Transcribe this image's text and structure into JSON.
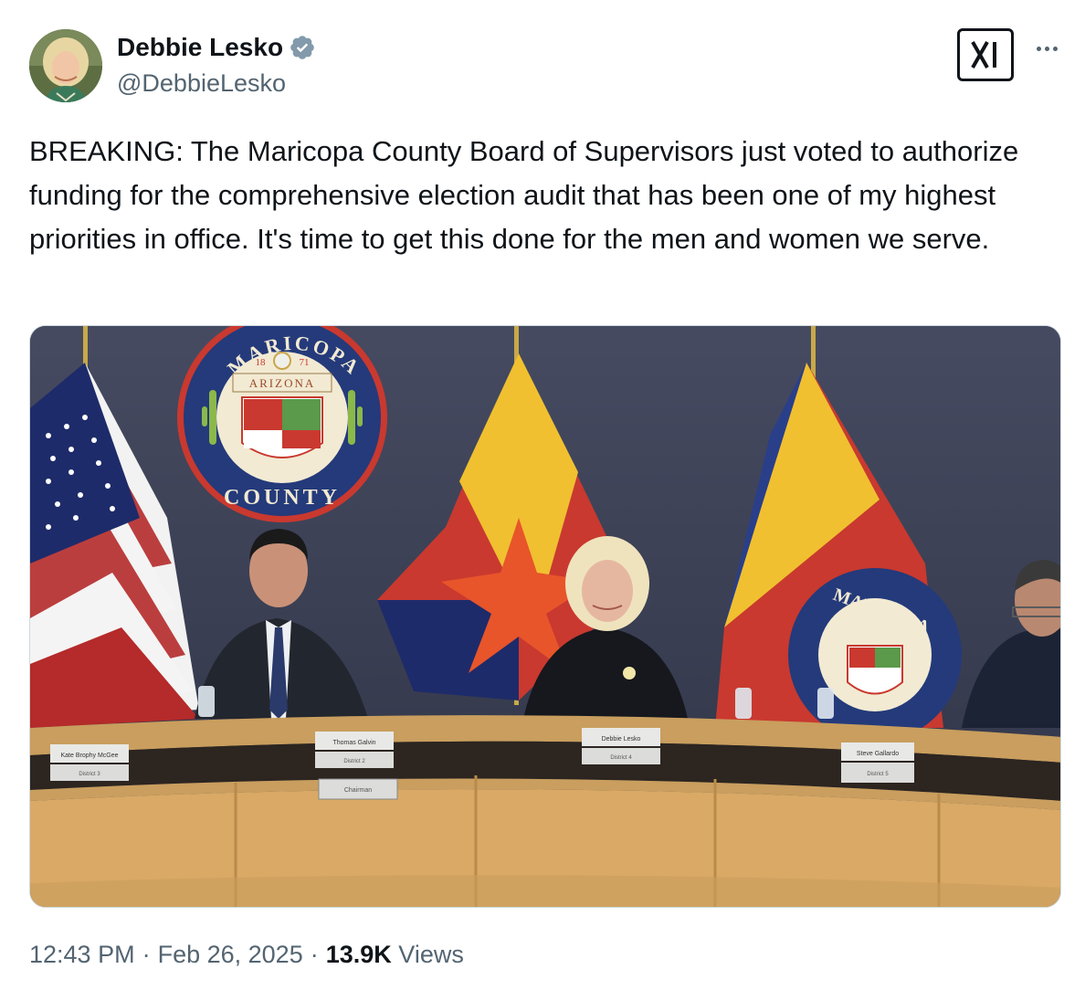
{
  "author": {
    "display_name": "Debbie Lesko",
    "handle": "@DebbieLesko",
    "verified": true,
    "verified_color": "#829aab",
    "avatar_icon": "profile-photo"
  },
  "header_actions": {
    "logo_icon": "grok-icon",
    "more_icon": "more-dots-icon"
  },
  "tweet": {
    "text": "BREAKING: The Maricopa County Board of Supervisors just voted to authorize funding for the comprehensive election audit that has been one of my highest priorities in office. It's time to get this done for the men and women we serve."
  },
  "media": {
    "seal": {
      "top_text": "MARICOPA",
      "bottom_text": "COUNTY",
      "state_text": "ARIZONA",
      "year_left": "18",
      "year_right": "71"
    },
    "flag_seal_text": "MARICOPA",
    "nameplates": [
      {
        "name": "Kate Brophy McGee",
        "district": "District 3"
      },
      {
        "name": "Thomas Galvin",
        "district": "District 2",
        "title": "Chairman"
      },
      {
        "name": "Debbie Lesko",
        "district": "District 4"
      },
      {
        "name": "Steve Gallardo",
        "district": "District 5"
      }
    ]
  },
  "meta": {
    "time": "12:43 PM",
    "separator": "·",
    "date": "Feb 26, 2025",
    "views_count": "13.9K",
    "views_label": "Views"
  }
}
